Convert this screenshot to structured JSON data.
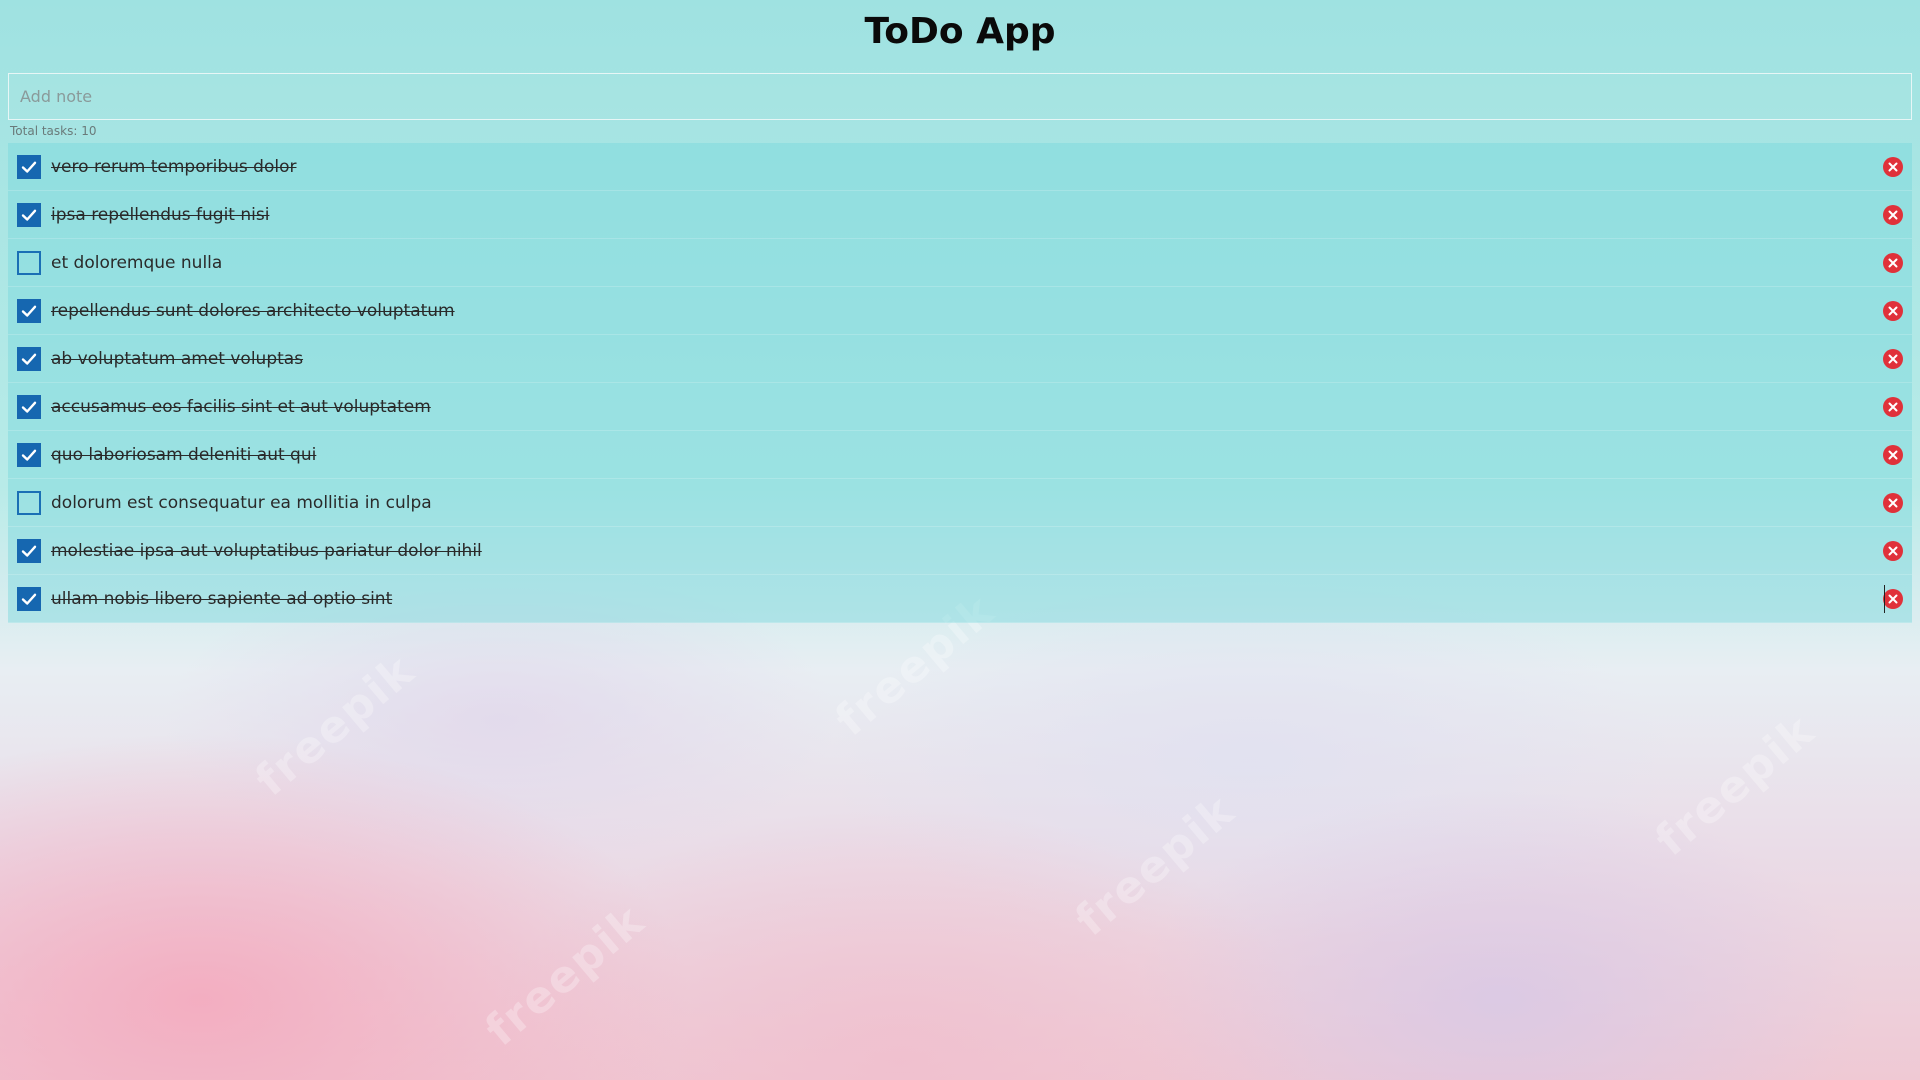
{
  "app": {
    "title": "ToDo App"
  },
  "add_note": {
    "placeholder": "Add note",
    "value": ""
  },
  "summary": {
    "total_text": "Total tasks: 10"
  },
  "todos": [
    {
      "text": "vero rerum temporibus dolor",
      "completed": true
    },
    {
      "text": "ipsa repellendus fugit nisi",
      "completed": true
    },
    {
      "text": "et doloremque nulla",
      "completed": false
    },
    {
      "text": "repellendus sunt dolores architecto voluptatum",
      "completed": true
    },
    {
      "text": "ab voluptatum amet voluptas",
      "completed": true
    },
    {
      "text": "accusamus eos facilis sint et aut voluptatem",
      "completed": true
    },
    {
      "text": "quo laboriosam deleniti aut qui",
      "completed": true
    },
    {
      "text": "dolorum est consequatur ea mollitia in culpa",
      "completed": false
    },
    {
      "text": "molestiae ipsa aut voluptatibus pariatur dolor nihil",
      "completed": true
    },
    {
      "text": "ullam nobis libero sapiente ad optio sint",
      "completed": true
    }
  ],
  "icons": {
    "checkbox": "check-icon",
    "delete": "close-circle-icon"
  },
  "colors": {
    "checkbox": "#1667b0",
    "delete": "#e0313a",
    "row_tint": "#78d7dc"
  },
  "background": {
    "watermark": "freepik"
  }
}
